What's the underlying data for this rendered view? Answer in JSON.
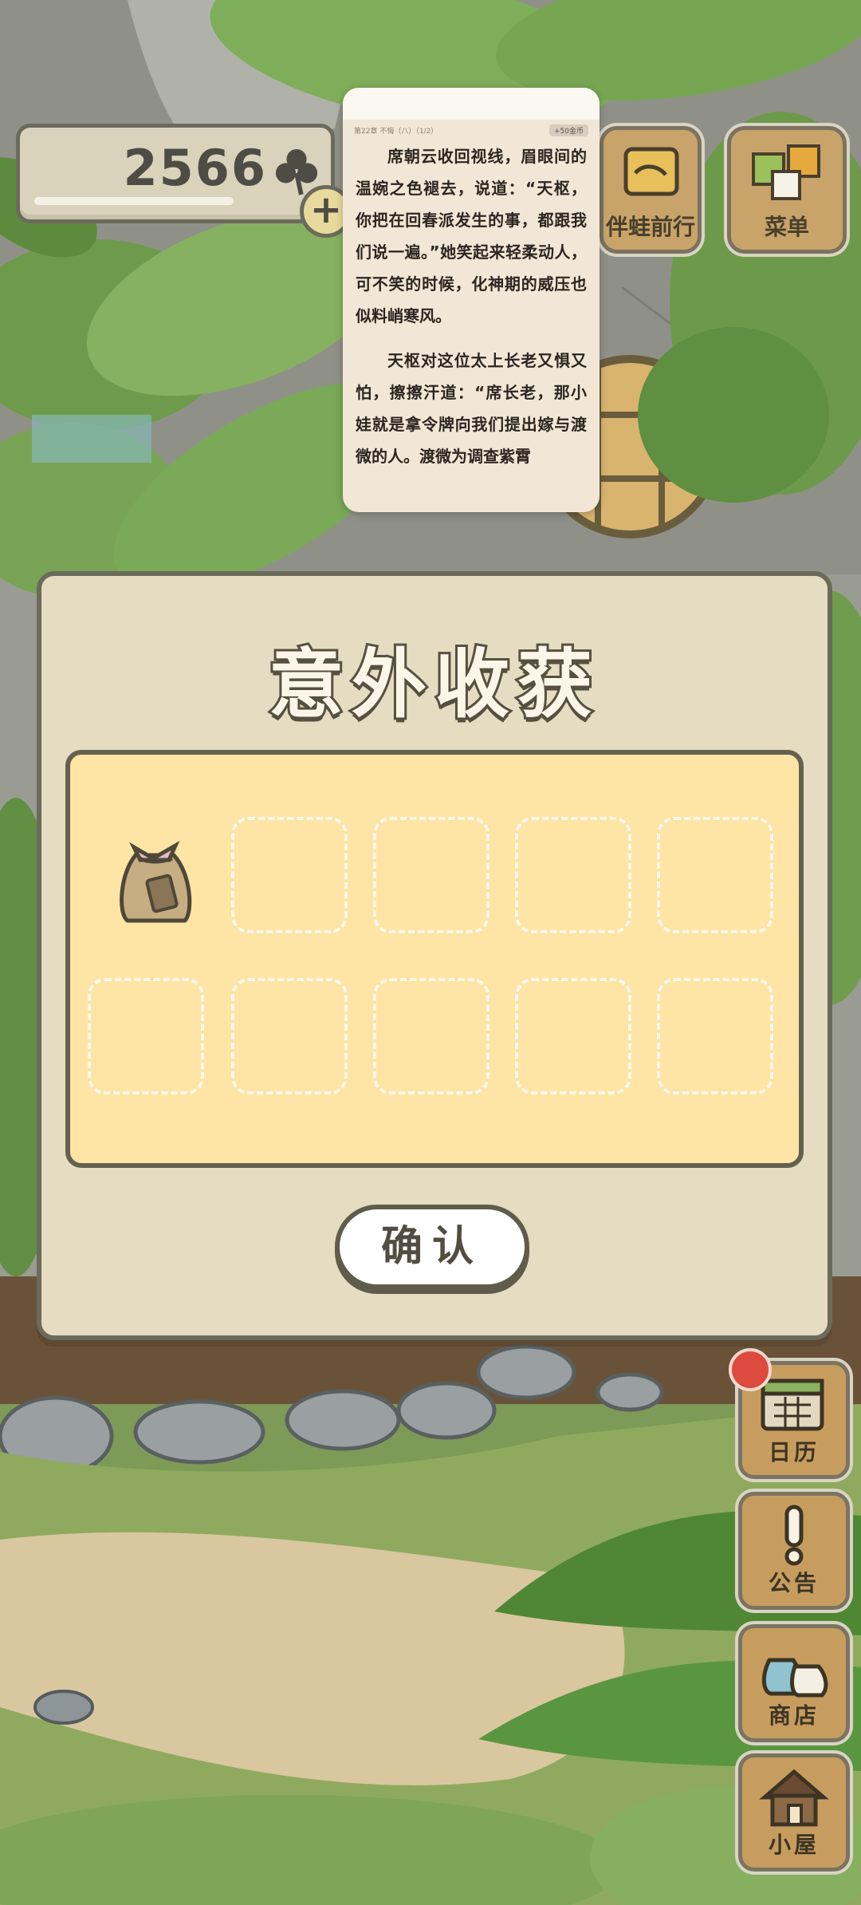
{
  "header": {
    "clover_count": "2566",
    "clover_icon": "clover-icon",
    "add_icon": "plus-icon"
  },
  "top_buttons": {
    "companion_label": "伴蛙前行",
    "menu_label": "菜单"
  },
  "reader": {
    "chapter": "第22章 不悔（八）（1/2）",
    "coin_chip": "+50金币",
    "paragraphs": [
      "席朝云收回视线，眉眼间的温婉之色褪去，说道：“天枢，你把在回春派发生的事，都跟我们说一遍。”她笑起来轻柔动人，可不笑的时候，化神期的威压也似料峭寒风。",
      "天枢对这位太上长老又惧又怕，擦擦汗道：“席长老，那小娃就是拿令牌向我们提出嫁与渡微的人。渡微为调查紫霄"
    ]
  },
  "dialog": {
    "title": "意外收获",
    "items": [
      {
        "slot": 1,
        "item_icon": "bag-icon",
        "filled": true
      },
      {
        "slot": 2,
        "filled": false
      },
      {
        "slot": 3,
        "filled": false
      },
      {
        "slot": 4,
        "filled": false
      },
      {
        "slot": 5,
        "filled": false
      },
      {
        "slot": 6,
        "filled": false
      },
      {
        "slot": 7,
        "filled": false
      },
      {
        "slot": 8,
        "filled": false
      },
      {
        "slot": 9,
        "filled": false
      },
      {
        "slot": 10,
        "filled": false
      }
    ],
    "confirm_label": "确认"
  },
  "side_nav": {
    "calendar_label": "日历",
    "notice_label": "公告",
    "shop_label": "商店",
    "house_label": "小屋"
  },
  "colors": {
    "dialog_bg": "#e6dcc1",
    "panel_bg": "#fee4a5",
    "outline": "#64614f",
    "wood": "#c79d5f",
    "notification": "#dd4a3e"
  }
}
